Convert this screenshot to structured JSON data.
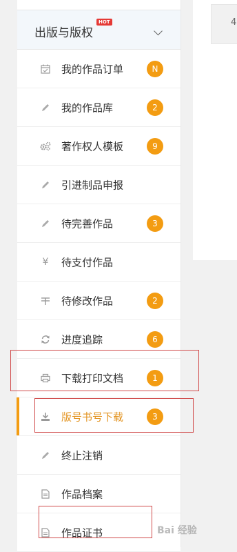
{
  "sidebar": {
    "section": {
      "title": "出版与版权",
      "hot_badge": "HOT"
    },
    "items": [
      {
        "name": "my-work-orders",
        "label": "我的作品订单",
        "icon": "calendar-check-icon",
        "badge": "N"
      },
      {
        "name": "my-works-library",
        "label": "我的作品库",
        "icon": "pencil-icon",
        "badge": "2"
      },
      {
        "name": "copyright-owner-templates",
        "label": "著作权人模板",
        "icon": "gears-icon",
        "badge": "9"
      },
      {
        "name": "import-product-declaration",
        "label": "引进制品申报",
        "icon": "pencil-icon",
        "badge": ""
      },
      {
        "name": "works-to-complete",
        "label": "待完善作品",
        "icon": "pencil-icon",
        "badge": "3"
      },
      {
        "name": "works-to-pay",
        "label": "待支付作品",
        "icon": "yen-icon",
        "badge": ""
      },
      {
        "name": "works-to-modify",
        "label": "待修改作品",
        "icon": "tax-icon",
        "badge": "2"
      },
      {
        "name": "progress-tracking",
        "label": "进度追踪",
        "icon": "refresh-icon",
        "badge": "6"
      },
      {
        "name": "download-print-docs",
        "label": "下载打印文档",
        "icon": "print-icon",
        "badge": "1"
      },
      {
        "name": "isbn-download",
        "label": "版号书号下载",
        "icon": "download-icon",
        "badge": "3",
        "active": true
      },
      {
        "name": "terminate-cancel",
        "label": "终止注销",
        "icon": "pencil-icon",
        "badge": ""
      },
      {
        "name": "work-archives",
        "label": "作品档案",
        "icon": "document-icon",
        "badge": ""
      },
      {
        "name": "work-certificate",
        "label": "作品证书",
        "icon": "document-icon",
        "badge": ""
      }
    ]
  },
  "content": {
    "partial_text": "4"
  },
  "watermark": {
    "text": "Bai 经验"
  },
  "colors": {
    "accent": "#f39c12",
    "active_text": "#e39422",
    "highlight_border": "#d04a4a",
    "hot_badge": "#e53935"
  }
}
